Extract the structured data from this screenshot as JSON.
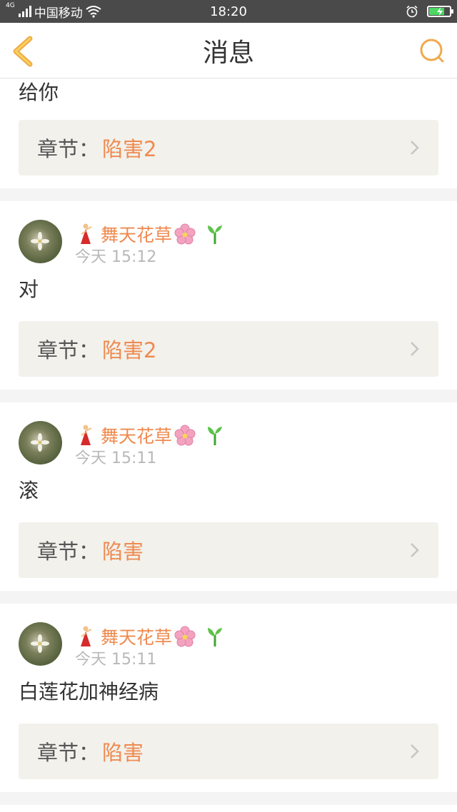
{
  "status_bar": {
    "network_tag": "4G",
    "carrier": "中国移动",
    "time": "18:20",
    "icons": [
      "signal-icon",
      "wifi-icon",
      "alarm-icon",
      "battery-charging-icon"
    ],
    "battery_level": 0.75,
    "battery_color": "#4cd964"
  },
  "nav": {
    "title": "消息",
    "back_icon": "chevron-left-icon",
    "search_icon": "search-icon",
    "accent": "#f0a94c"
  },
  "colors": {
    "accent_orange": "#ef8a4f",
    "chapter_bg": "#f2f1ec",
    "separator": "#f4f4f4",
    "timestamp": "#b8b8b8"
  },
  "messages": [
    {
      "text": "给你",
      "chapter_label": "章节：",
      "chapter_name": "陷害2"
    },
    {
      "user": "舞天花草",
      "time": "今天 15:12",
      "text": "对",
      "chapter_label": "章节：",
      "chapter_name": "陷害2"
    },
    {
      "user": "舞天花草",
      "time": "今天 15:11",
      "text": "滚",
      "chapter_label": "章节：",
      "chapter_name": "陷害"
    },
    {
      "user": "舞天花草",
      "time": "今天 15:11",
      "text": "白莲花加神经病",
      "chapter_label": "章节：",
      "chapter_name": "陷害"
    }
  ]
}
